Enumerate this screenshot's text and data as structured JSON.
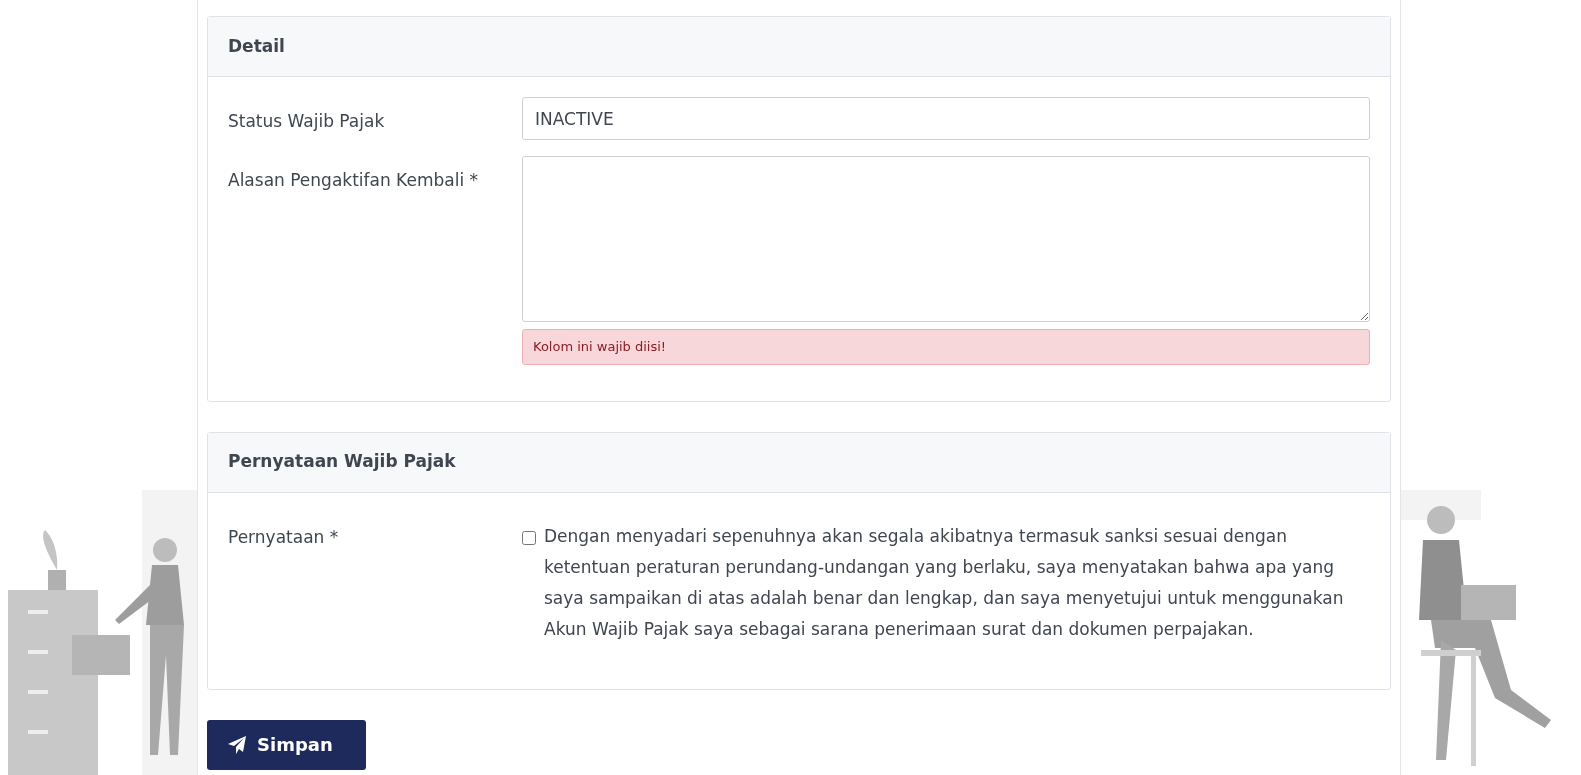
{
  "sections": [
    {
      "title": "Detail",
      "fields": [
        {
          "kind": "text",
          "label": "Status Wajib Pajak",
          "value": "INACTIVE"
        },
        {
          "kind": "textarea",
          "label": "Alasan Pengaktifan Kembali *",
          "error": "Kolom ini wajib diisi!"
        }
      ]
    },
    {
      "title": "Pernyataan Wajib Pajak",
      "fields": [
        {
          "kind": "checkbox",
          "label": "Pernyataan *",
          "checked": false,
          "text": "Dengan menyadari sepenuhnya akan segala akibatnya termasuk sanksi sesuai dengan ketentuan peraturan perundang-undangan yang berlaku, saya menyatakan bahwa apa yang saya sampaikan di atas adalah benar dan lengkap, dan saya menyetujui untuk menggunakan Akun Wajib Pajak saya sebagai sarana penerimaan surat dan dokumen perpajakan."
        }
      ]
    }
  ],
  "submit": {
    "label": "Simpan"
  }
}
